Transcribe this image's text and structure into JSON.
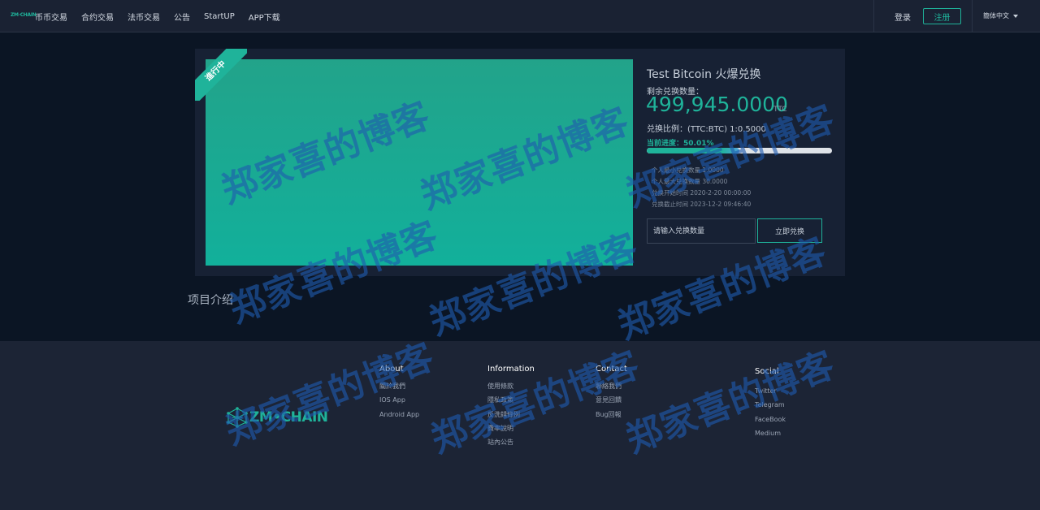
{
  "nav": {
    "logo_text": "ZM·CHAIN",
    "links": [
      "币币交易",
      "合约交易",
      "法币交易",
      "公告",
      "StartUP",
      "APP下载"
    ],
    "login": "登录",
    "register": "注册",
    "language": "簡体中文"
  },
  "project": {
    "ribbon": "進行中",
    "title": "Test Bitcoin 火爆兑换",
    "remain_label": "剩余兑换数量：",
    "remain_value": "499,945.0000",
    "remain_unit": "TTC",
    "ratio": "兑换比例：(TTC:BTC) 1:0.5000",
    "progress_label": "当前进度：50.01%",
    "progress_percent": 50.01,
    "info": [
      "个人最小兑换数量 1.0000",
      "个人最大兑换数量 30.0000",
      "兑换开始时间 2020-2-20 00:00:00",
      "兑换截止时间 2023-12-2 09:46:40"
    ],
    "input_placeholder": "请输入兑换数量",
    "button": "立即兑换",
    "intro_heading": "项目介绍"
  },
  "footer": {
    "logo": "ZM•CHAIN",
    "columns": [
      {
        "title": "About",
        "links": [
          "關於我們",
          "IOS App",
          "Android App"
        ]
      },
      {
        "title": "Information",
        "links": [
          "使用條款",
          "隱私政策",
          "反洗錢條例",
          "費率說明",
          "站內公告"
        ]
      },
      {
        "title": "Contact",
        "links": [
          "聯絡我們",
          "意見回饋",
          "Bug回報"
        ]
      },
      {
        "title": "Social",
        "links": [
          "Twitter",
          "Telegram",
          "FaceBook",
          "Medium"
        ]
      }
    ]
  },
  "watermark": "郑家喜的博客",
  "colors": {
    "accent": "#1fb39a",
    "background": "#0b1524",
    "nav": "#1a2233",
    "footer": "#1c2435"
  }
}
